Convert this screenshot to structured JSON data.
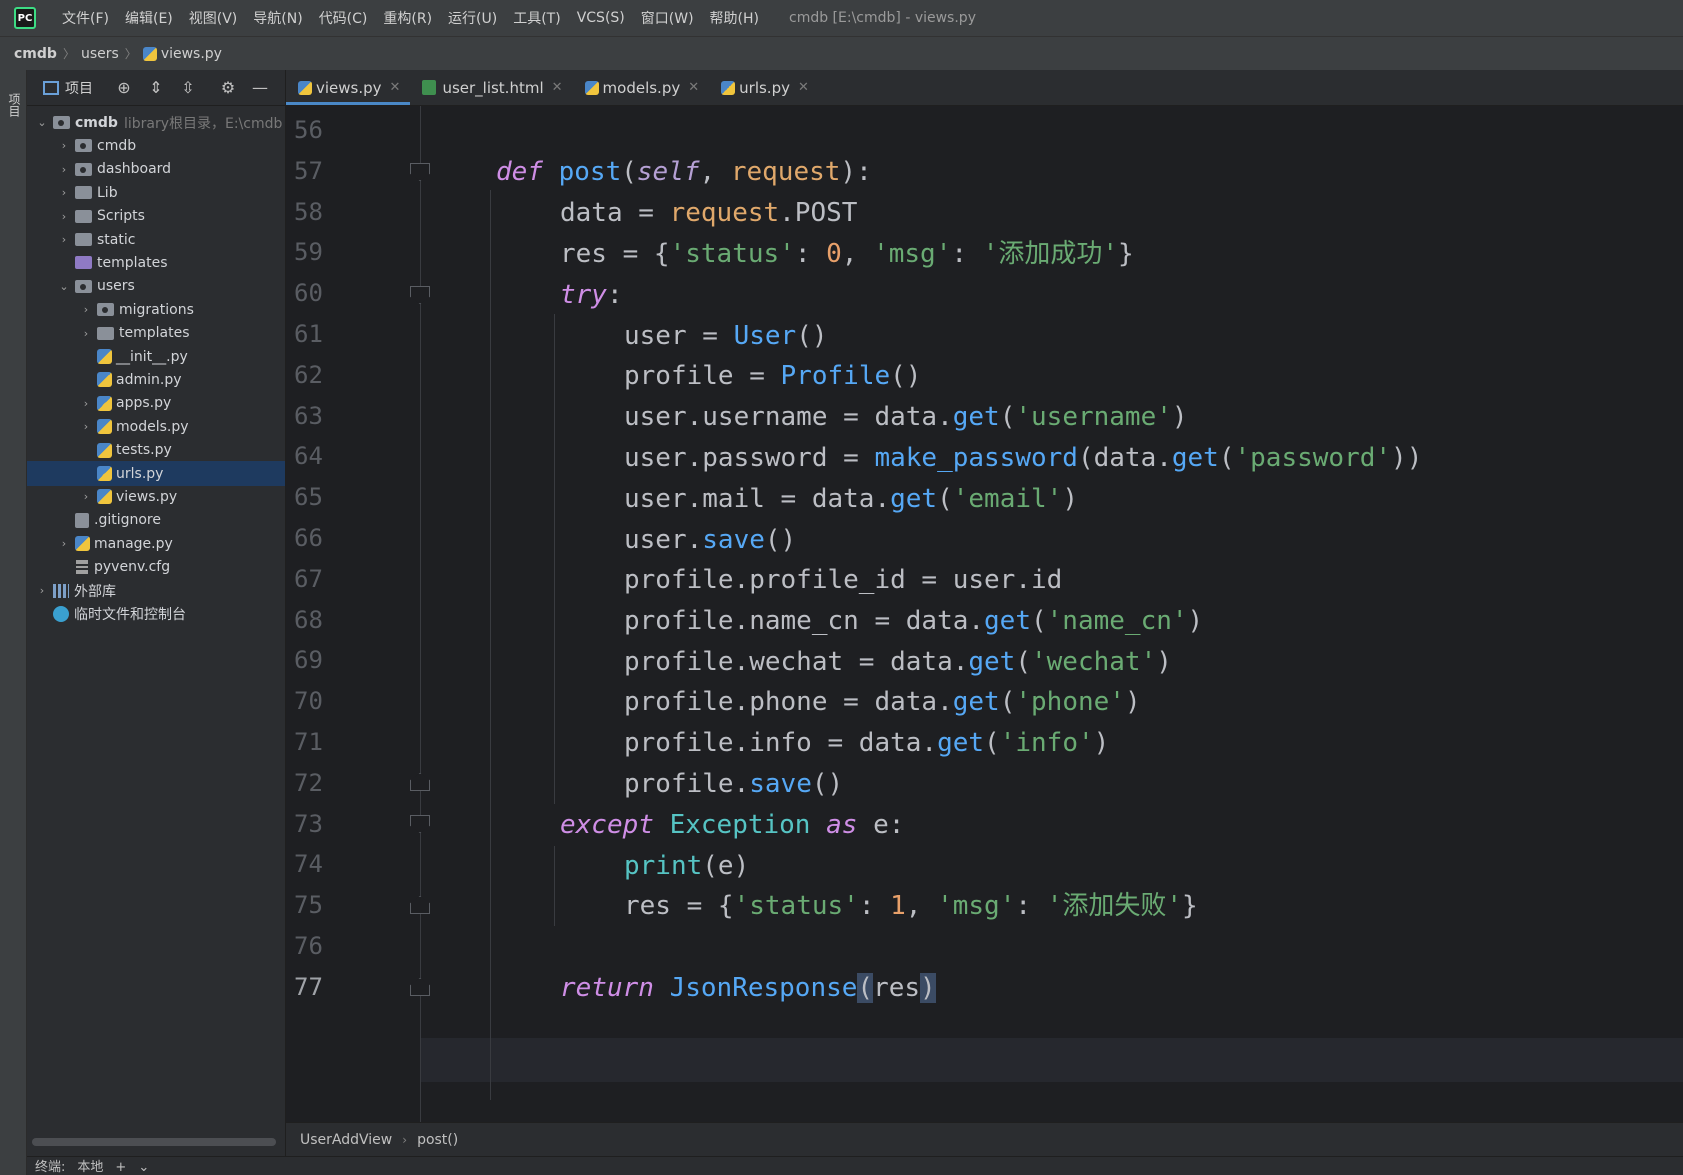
{
  "menubar": {
    "logo": "PC",
    "items": [
      "文件(F)",
      "编辑(E)",
      "视图(V)",
      "导航(N)",
      "代码(C)",
      "重构(R)",
      "运行(U)",
      "工具(T)",
      "VCS(S)",
      "窗口(W)",
      "帮助(H)"
    ],
    "window_title": "cmdb [E:\\cmdb] - views.py"
  },
  "breadcrumb": [
    "cmdb",
    "users",
    "views.py"
  ],
  "left_strip": {
    "project_label": "项目"
  },
  "panel": {
    "title": "项目",
    "tree": [
      {
        "label": "cmdb",
        "extra": "library根目录，E:\\cmdb",
        "depth": 0,
        "chev": "down",
        "icon": "folder-module",
        "bold": true
      },
      {
        "label": "cmdb",
        "depth": 1,
        "chev": "right",
        "icon": "folder-module"
      },
      {
        "label": "dashboard",
        "depth": 1,
        "chev": "right",
        "icon": "folder-module"
      },
      {
        "label": "Lib",
        "depth": 1,
        "chev": "right",
        "icon": "folder"
      },
      {
        "label": "Scripts",
        "depth": 1,
        "chev": "right",
        "icon": "folder"
      },
      {
        "label": "static",
        "depth": 1,
        "chev": "right",
        "icon": "folder"
      },
      {
        "label": "templates",
        "depth": 1,
        "chev": "",
        "icon": "folder-purple"
      },
      {
        "label": "users",
        "depth": 1,
        "chev": "down",
        "icon": "folder-module"
      },
      {
        "label": "migrations",
        "depth": 2,
        "chev": "right",
        "icon": "folder-module"
      },
      {
        "label": "templates",
        "depth": 2,
        "chev": "right",
        "icon": "folder"
      },
      {
        "label": "__init__.py",
        "depth": 2,
        "chev": "",
        "icon": "py"
      },
      {
        "label": "admin.py",
        "depth": 2,
        "chev": "",
        "icon": "py"
      },
      {
        "label": "apps.py",
        "depth": 2,
        "chev": "right",
        "icon": "py"
      },
      {
        "label": "models.py",
        "depth": 2,
        "chev": "right",
        "icon": "py"
      },
      {
        "label": "tests.py",
        "depth": 2,
        "chev": "",
        "icon": "py"
      },
      {
        "label": "urls.py",
        "depth": 2,
        "chev": "",
        "icon": "py",
        "selected": true
      },
      {
        "label": "views.py",
        "depth": 2,
        "chev": "right",
        "icon": "py"
      },
      {
        "label": ".gitignore",
        "depth": 1,
        "chev": "",
        "icon": "git"
      },
      {
        "label": "manage.py",
        "depth": 1,
        "chev": "right",
        "icon": "py"
      },
      {
        "label": "pyvenv.cfg",
        "depth": 1,
        "chev": "",
        "icon": "cfg"
      },
      {
        "label": "外部库",
        "depth": 0,
        "chev": "right",
        "icon": "lib"
      },
      {
        "label": "临时文件和控制台",
        "depth": 0,
        "chev": "",
        "icon": "scratch"
      }
    ]
  },
  "tabs": [
    {
      "label": "views.py",
      "icon": "py",
      "active": true
    },
    {
      "label": "user_list.html",
      "icon": "html"
    },
    {
      "label": "models.py",
      "icon": "py"
    },
    {
      "label": "urls.py",
      "icon": "py"
    }
  ],
  "editor": {
    "line_numbers": [
      "56",
      "57",
      "58",
      "59",
      "60",
      "61",
      "62",
      "63",
      "64",
      "65",
      "66",
      "67",
      "68",
      "69",
      "70",
      "71",
      "72",
      "73",
      "74",
      "75",
      "76",
      "77"
    ]
  },
  "editor_crumbs": [
    "UserAddView",
    "post()"
  ],
  "bottom": {
    "terminal_label": "终端:",
    "local_tab": "本地",
    "add": "+",
    "more": "⌄"
  }
}
